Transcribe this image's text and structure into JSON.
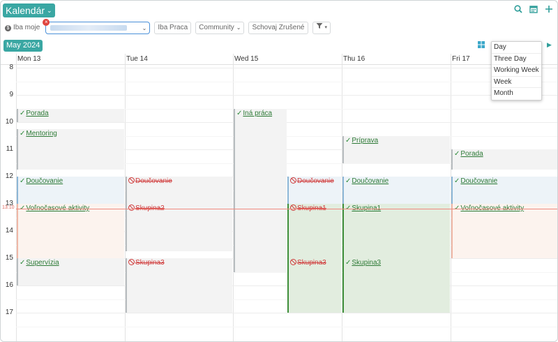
{
  "app": {
    "title": "Kalendár"
  },
  "toolbar": {
    "icons": [
      "search-icon",
      "calendar-icon",
      "plus-icon"
    ]
  },
  "filters": {
    "only_mine": "Iba moje",
    "only_work": "Iba Praca",
    "community": "Community",
    "hide_cancelled": "Schovaj Zrušené"
  },
  "month_label": "May 2024",
  "days": [
    "Mon 13",
    "Tue 14",
    "Wed 15",
    "Thu 16",
    "Fri 17"
  ],
  "hours": [
    "8",
    "9",
    "10",
    "11",
    "12",
    "13",
    "14",
    "15",
    "16",
    "17"
  ],
  "now": {
    "label": "13:10"
  },
  "views": [
    "Day",
    "Three Day",
    "Working Week",
    "Week",
    "Month"
  ],
  "events": [
    {
      "day": 0,
      "title": "Porada",
      "start": 9.5,
      "end": 10.0,
      "status": "ok",
      "style": "gray"
    },
    {
      "day": 0,
      "title": "Mentoring",
      "start": 10.25,
      "end": 11.75,
      "status": "ok",
      "style": "gray"
    },
    {
      "day": 0,
      "title": "Doučovanie",
      "start": 12.0,
      "end": 13.0,
      "status": "ok",
      "style": "blue"
    },
    {
      "day": 0,
      "title": "Voľnočasové aktivity",
      "start": 13.0,
      "end": 15.0,
      "status": "ok",
      "style": "peach"
    },
    {
      "day": 0,
      "title": "Supervízia",
      "start": 15.0,
      "end": 16.0,
      "status": "ok",
      "style": "gray"
    },
    {
      "day": 1,
      "title": "Doučovanie",
      "start": 12.0,
      "end": 13.0,
      "status": "cancel",
      "style": "gray"
    },
    {
      "day": 1,
      "title": "Skupina2",
      "start": 13.0,
      "end": 14.75,
      "status": "cancel",
      "style": "gray"
    },
    {
      "day": 1,
      "title": "Skupina3",
      "start": 15.0,
      "end": 17.0,
      "status": "cancel",
      "style": "gray"
    },
    {
      "day": 2,
      "title": "Iná práca",
      "start": 9.5,
      "end": 15.5,
      "status": "ok",
      "style": "gray"
    },
    {
      "day": 2,
      "title": "Doučovanie",
      "start": 12.0,
      "end": 13.0,
      "status": "cancel",
      "style": "blue",
      "half": "right"
    },
    {
      "day": 2,
      "title": "Skupina1",
      "start": 13.0,
      "end": 15.0,
      "status": "cancel",
      "style": "green",
      "half": "right"
    },
    {
      "day": 2,
      "title": "Skupina3",
      "start": 15.0,
      "end": 17.0,
      "status": "cancel",
      "style": "green",
      "half": "right"
    },
    {
      "day": 3,
      "title": "Príprava",
      "start": 10.5,
      "end": 11.5,
      "status": "ok",
      "style": "gray"
    },
    {
      "day": 3,
      "title": "Doučovanie",
      "start": 12.0,
      "end": 13.0,
      "status": "ok",
      "style": "blue"
    },
    {
      "day": 3,
      "title": "Skupina1",
      "start": 13.0,
      "end": 15.0,
      "status": "ok",
      "style": "green"
    },
    {
      "day": 3,
      "title": "Skupina3",
      "start": 15.0,
      "end": 17.0,
      "status": "ok",
      "style": "green"
    },
    {
      "day": 4,
      "title": "Porada",
      "start": 11.0,
      "end": 11.75,
      "status": "ok",
      "style": "gray"
    },
    {
      "day": 4,
      "title": "Doučovanie",
      "start": 12.0,
      "end": 13.0,
      "status": "ok",
      "style": "blue"
    },
    {
      "day": 4,
      "title": "Voľnočasové aktivity",
      "start": 13.0,
      "end": 15.0,
      "status": "ok",
      "style": "peach"
    }
  ]
}
